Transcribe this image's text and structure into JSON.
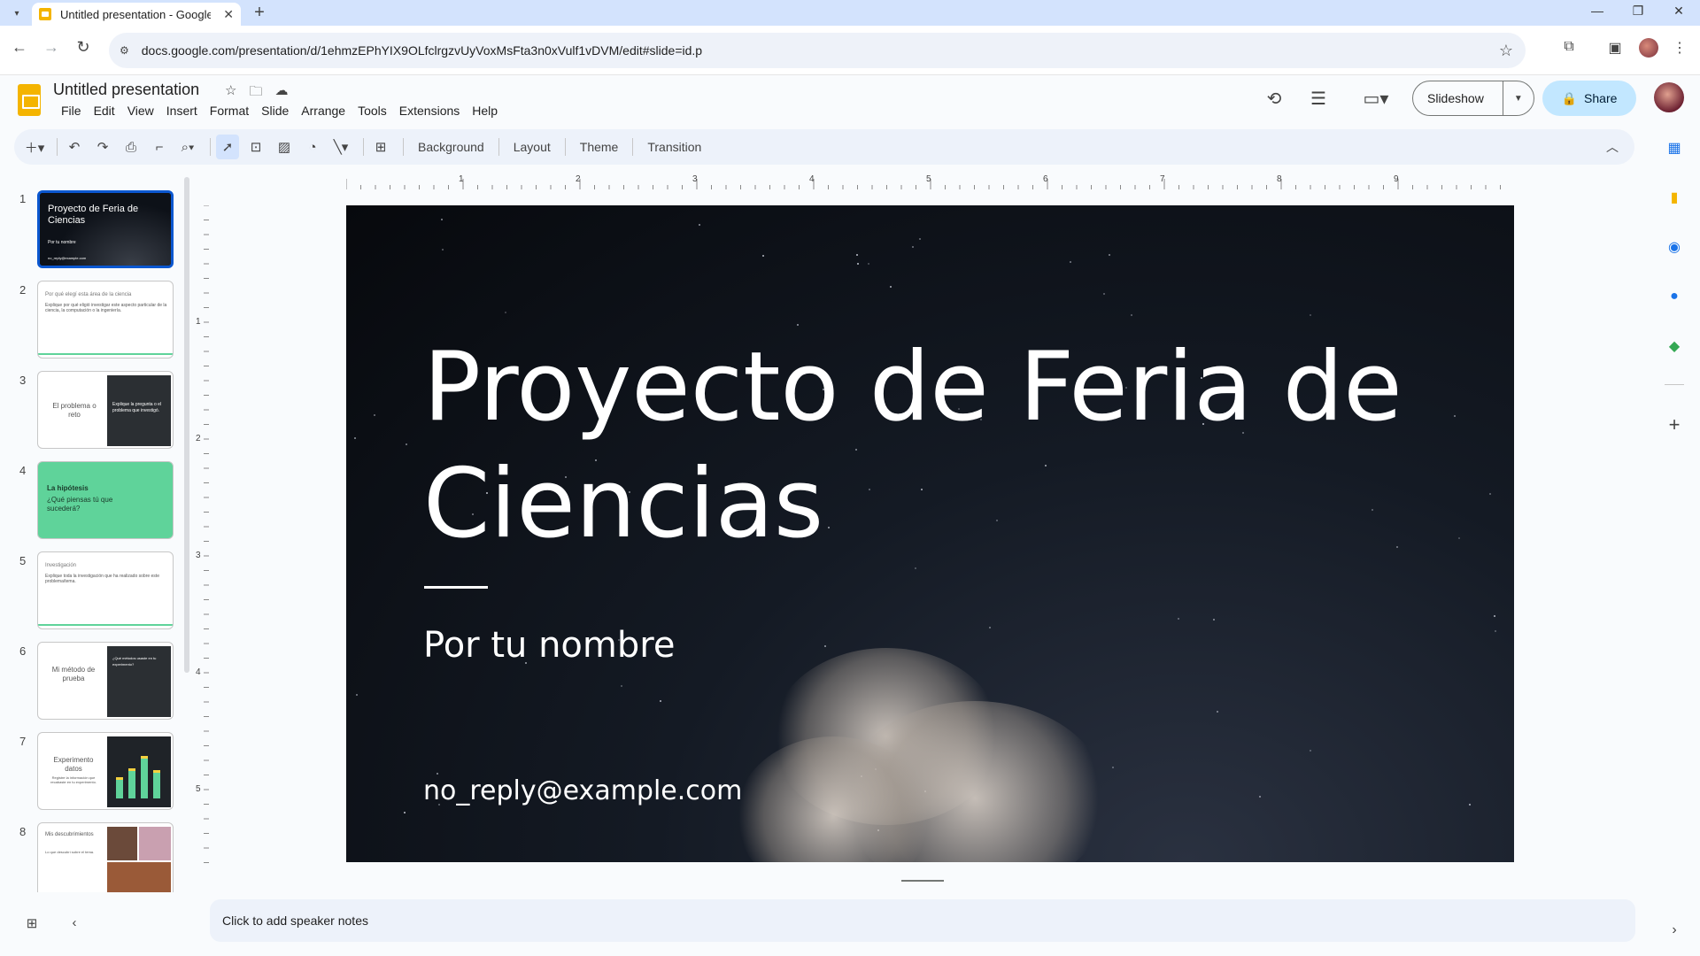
{
  "browser": {
    "tab_title": "Untitled presentation - Google Slides",
    "url": "docs.google.com/presentation/d/1ehmzEPhYIX9OLfclrgzvUyVoxMsFta3n0xVulf1vDVM/edit#slide=id.p",
    "new_tab_label": "+",
    "tab_close_label": "✕"
  },
  "header": {
    "doc_title": "Untitled presentation",
    "menus": [
      "File",
      "Edit",
      "View",
      "Insert",
      "Format",
      "Slide",
      "Arrange",
      "Tools",
      "Extensions",
      "Help"
    ],
    "slideshow_label": "Slideshow",
    "share_label": "Share"
  },
  "toolbar": {
    "background_label": "Background",
    "layout_label": "Layout",
    "theme_label": "Theme",
    "transition_label": "Transition"
  },
  "filmstrip": {
    "slides": [
      {
        "num": "1",
        "title": "Proyecto de Feria de Ciencias",
        "subtitle": "Por tu nombre",
        "footer": "no_reply@example.com"
      },
      {
        "num": "2",
        "title": "Por qué elegí esta área de la ciencia",
        "body": "Explique por qué eligió investigar este aspecto particular de la ciencia, la computación o la ingeniería."
      },
      {
        "num": "3",
        "title": "El problema o reto",
        "body": "Explique la pregunta o el problema que investigó."
      },
      {
        "num": "4",
        "title": "La hipótesis",
        "body": "¿Qué piensas tú que sucederá?"
      },
      {
        "num": "5",
        "title": "Investigación",
        "body": "Explique toda la investigación que ha realizado sobre este problema/tema."
      },
      {
        "num": "6",
        "title": "Mi método de prueba",
        "body": "¿Qué métodos usaste en tu experimento?"
      },
      {
        "num": "7",
        "title": "Experimento datos",
        "body": "Registre la información que recabaste en tu experimento."
      },
      {
        "num": "8",
        "title": "Mis descubrimientos",
        "body": "Lo que descubrí sobre el tema."
      }
    ]
  },
  "slide": {
    "title": "Proyecto de Feria de Ciencias",
    "subtitle": "Por tu nombre",
    "email": "no_reply@example.com"
  },
  "rulers": {
    "horizontal": [
      "1",
      "2",
      "3",
      "4",
      "5",
      "6",
      "7",
      "8",
      "9"
    ],
    "vertical": [
      "1",
      "2",
      "3",
      "4",
      "5"
    ]
  },
  "notes_placeholder": "Click to add speaker notes",
  "colors": {
    "accent": "#0b57d0",
    "share_bg": "#c2e7ff",
    "toolbar_bg": "#edf2fa",
    "slides_yellow": "#f4b400",
    "thumb_green": "#5fd39a"
  }
}
